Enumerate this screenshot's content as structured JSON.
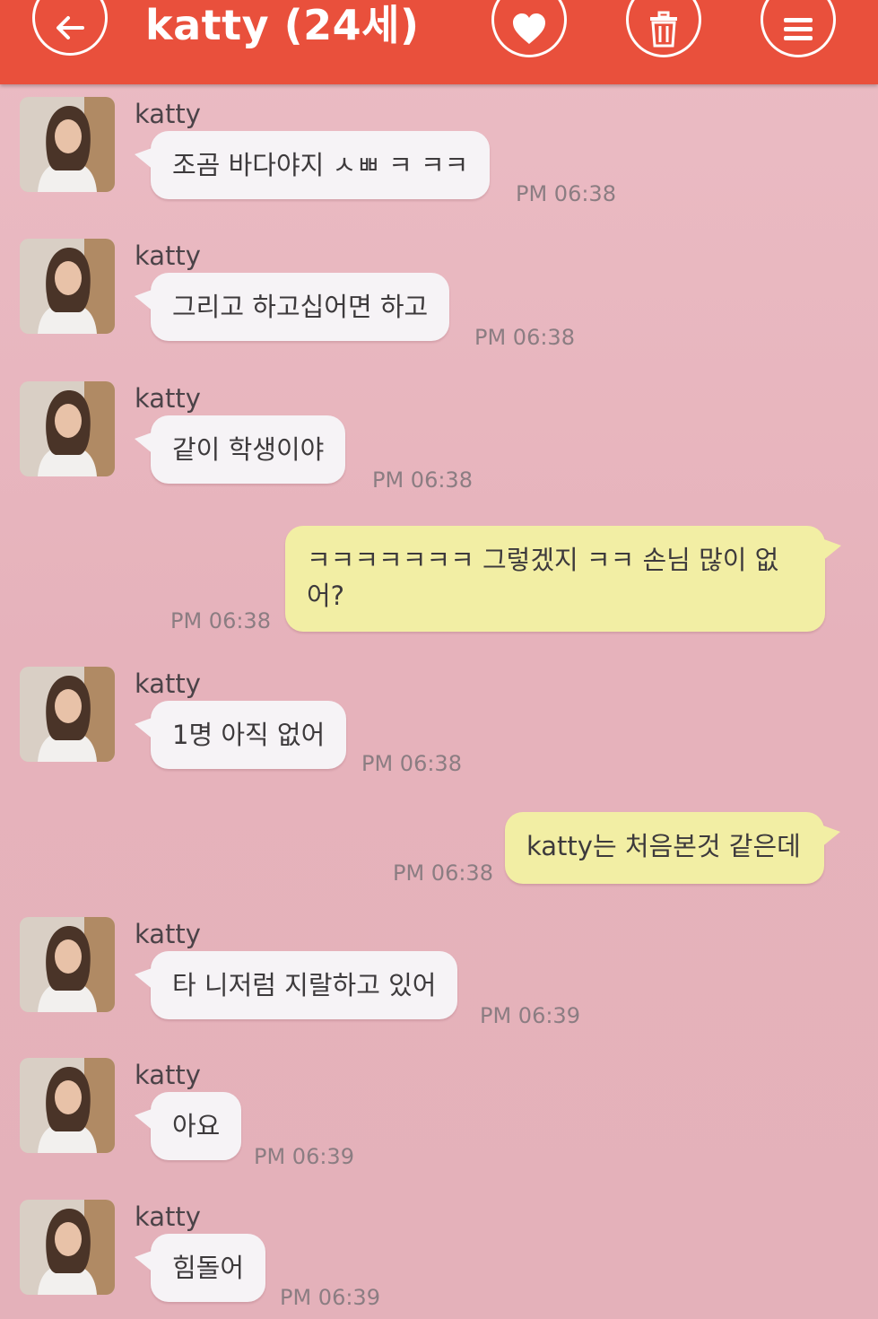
{
  "header": {
    "title": "katty (24세)",
    "colors": {
      "bar": "#e9503c",
      "icon": "#ffffff"
    },
    "icons": {
      "back": "back-arrow-icon",
      "like": "heart-icon",
      "delete": "trash-icon",
      "menu": "menu-icon"
    }
  },
  "conversation": {
    "background": "#e8b3bb",
    "incoming_bubble_color": "#f6f3f6",
    "outgoing_bubble_color": "#f2eea4",
    "messages": [
      {
        "sender": "katty",
        "text": "조곰 바다야지 ㅅㅃ ㅋ ㅋㅋ",
        "time": "PM 06:38"
      },
      {
        "sender": "katty",
        "text": "그리고 하고십어면 하고",
        "time": "PM 06:38"
      },
      {
        "sender": "katty",
        "text": "같이  학생이야",
        "time": "PM 06:38"
      },
      {
        "sender": "me",
        "text": "ㅋㅋㅋㅋㅋㅋㅋ 그렇겠지 ㅋㅋ 손님 많이 없어?",
        "time": "PM 06:38"
      },
      {
        "sender": "katty",
        "text": "1명 아직 없어",
        "time": "PM 06:38"
      },
      {
        "sender": "me",
        "text": "katty는 처음본것 같은데",
        "time": "PM 06:38"
      },
      {
        "sender": "katty",
        "text": "타 니저럼 지랄하고 있어",
        "time": "PM 06:39"
      },
      {
        "sender": "katty",
        "text": "아요",
        "time": "PM 06:39"
      },
      {
        "sender": "katty",
        "text": "힘돌어",
        "time": "PM 06:39"
      }
    ]
  }
}
